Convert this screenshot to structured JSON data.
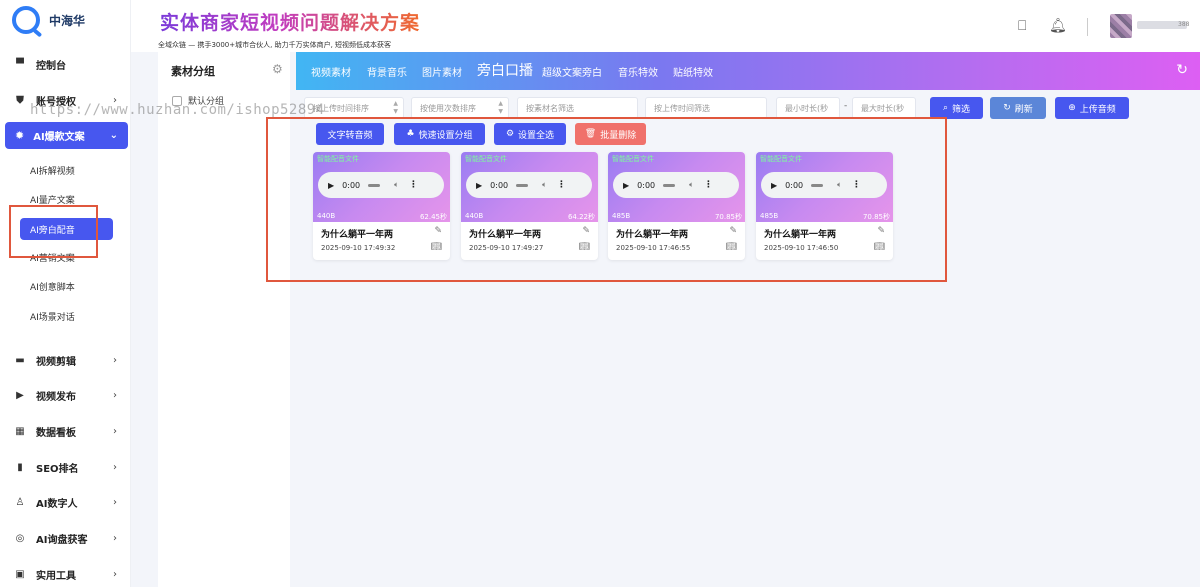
{
  "brand": {
    "name": "中海华"
  },
  "header": {
    "title": "实体商家短视频问题解决方案",
    "subtitle": "全域众链 — 携手3000+城市合伙人, 助力千万实体商户, 短视频低成本获客",
    "username_tail": "388"
  },
  "sidebar": {
    "items": [
      {
        "label": "控制台",
        "icon": "monitor-icon"
      },
      {
        "label": "账号授权",
        "icon": "shield-icon"
      },
      {
        "label": "AI爆款文案",
        "icon": "bulb-icon"
      },
      {
        "label": "视频剪辑",
        "icon": "video-edit-icon"
      },
      {
        "label": "视频发布",
        "icon": "video-publish-icon"
      },
      {
        "label": "数据看板",
        "icon": "dashboard-icon"
      },
      {
        "label": "SEO排名",
        "icon": "ranking-icon"
      },
      {
        "label": "AI数字人",
        "icon": "digital-human-icon"
      },
      {
        "label": "AI询盘获客",
        "icon": "headset-icon"
      },
      {
        "label": "实用工具",
        "icon": "toolbox-icon"
      }
    ],
    "sub_items": [
      "AI拆解视频",
      "AI量产文案",
      "AI旁白配音",
      "AI营销文案",
      "AI创意脚本",
      "AI场景对话"
    ]
  },
  "group_panel": {
    "title": "素材分组",
    "default_group": "默认分组"
  },
  "tabs": [
    "视频素材",
    "背景音乐",
    "图片素材",
    "旁白口播",
    "超级文案旁白",
    "音乐特效",
    "贴纸特效"
  ],
  "filters": {
    "upload_time_sort": "按上传时间排序",
    "usage_sort": "按使用次数排序",
    "name_filter": "按素材名筛选",
    "upload_time_filter": "按上传时间筛选",
    "min_duration": "最小时长(秒",
    "dash": "-",
    "max_duration": "最大时长(秒"
  },
  "actions": {
    "filter": "筛选",
    "refresh": "刷新",
    "upload": "上传音频",
    "text_to_audio": "文字转音频",
    "quick_group": "快速设置分组",
    "select_all": "设置全选",
    "batch_delete": "批量删除"
  },
  "watermark": "https://www.huzhan.com/ishop52894",
  "cards": [
    {
      "tag": "智能配音文件",
      "time": "0:00",
      "size": "440B",
      "duration": "62.45秒",
      "name": "为什么躺平一年两",
      "date": "2025-09-10 17:49:32"
    },
    {
      "tag": "智能配音文件",
      "time": "0:00",
      "size": "440B",
      "duration": "64.22秒",
      "name": "为什么躺平一年两",
      "date": "2025-09-10 17:49:27"
    },
    {
      "tag": "智能配音文件",
      "time": "0:00",
      "size": "485B",
      "duration": "70.85秒",
      "name": "为什么躺平一年两",
      "date": "2025-09-10 17:46:55"
    },
    {
      "tag": "智能配音文件",
      "time": "0:00",
      "size": "485B",
      "duration": "70.85秒",
      "name": "为什么躺平一年两",
      "date": "2025-09-10 17:46:50"
    }
  ],
  "colors": {
    "accent": "#4757ef",
    "highlight_box": "#e0573d"
  }
}
